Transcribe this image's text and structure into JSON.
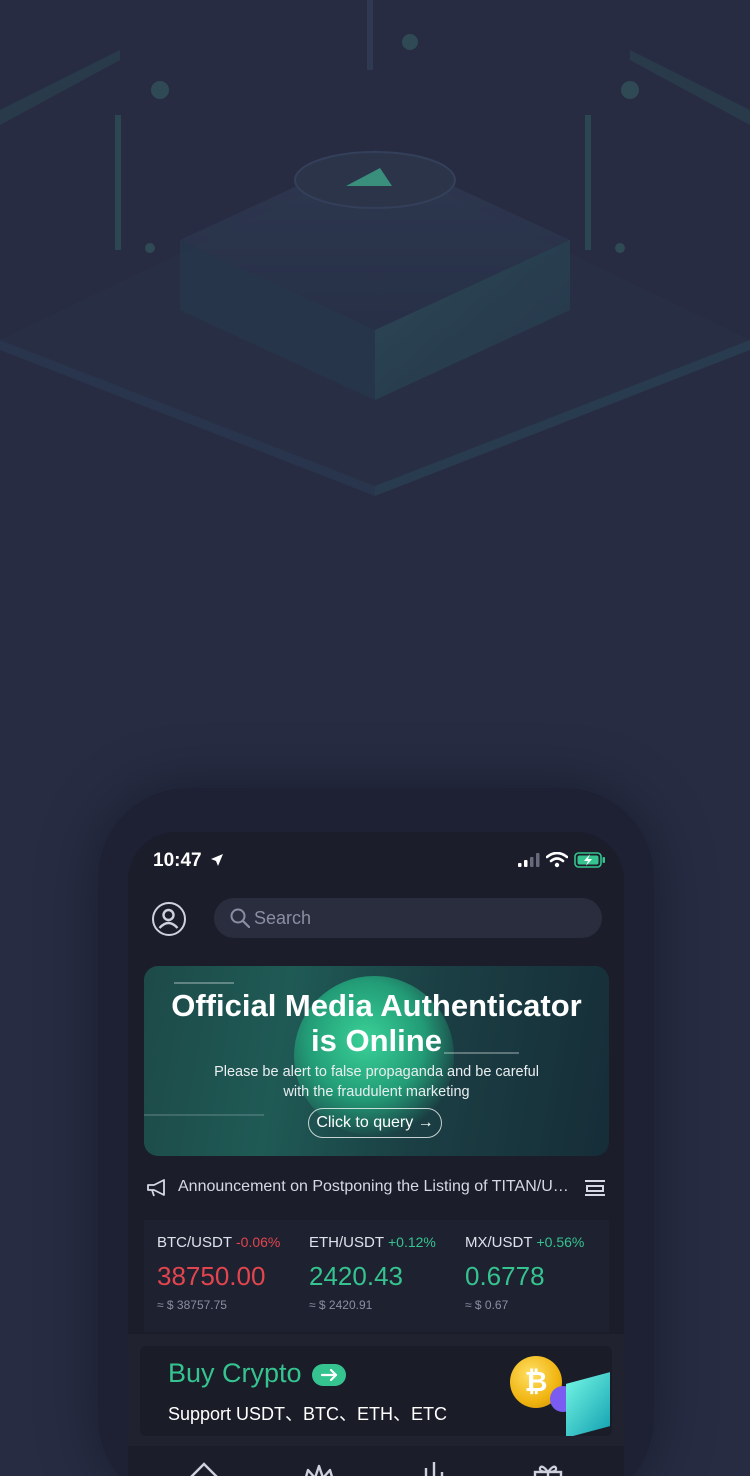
{
  "status_bar": {
    "time": "10:47"
  },
  "header": {
    "search_placeholder": "Search"
  },
  "banner": {
    "title_line1": "Official Media Authenticator",
    "title_line2": "is Online",
    "subtitle_line1": "Please be alert to false propaganda and be careful",
    "subtitle_line2": "with the fraudulent marketing",
    "button_label": "Click to query →"
  },
  "announcement": {
    "text": "Announcement on Postponing the Listing of TITAN/USDT"
  },
  "tickers": [
    {
      "pair": "BTC/USDT",
      "change": "-0.06%",
      "price": "38750.00",
      "usd": "≈ $ 38757.75",
      "color": "#e2454e"
    },
    {
      "pair": "ETH/USDT",
      "change": "+0.12%",
      "price": "2420.43",
      "usd": "≈ $ 2420.91",
      "color": "#35c38f"
    },
    {
      "pair": "MX/USDT",
      "change": "+0.56%",
      "price": "0.6778",
      "usd": "≈ $ 0.67",
      "color": "#35c38f"
    }
  ],
  "buy_crypto": {
    "title": "Buy Crypto",
    "subtitle": "Support USDT、BTC、ETH、ETC"
  },
  "colors": {
    "background": "#272c43",
    "accent_green": "#35c38f",
    "negative_red": "#e2454e"
  },
  "icons": {
    "status": [
      "location-arrow-icon",
      "signal-icon",
      "wifi-icon",
      "battery-charging-icon"
    ],
    "header": [
      "user-avatar-icon",
      "search-icon"
    ],
    "announcement": [
      "megaphone-icon",
      "list-icon"
    ],
    "tabbar": [
      "home-icon",
      "crown-icon",
      "markets-icon",
      "gift-icon"
    ]
  }
}
